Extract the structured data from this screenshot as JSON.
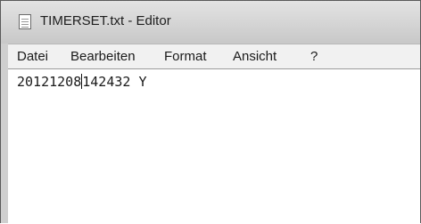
{
  "window": {
    "title": "TIMERSET.txt - Editor"
  },
  "menu": {
    "items": [
      {
        "label": "Datei"
      },
      {
        "label": "Bearbeiten"
      },
      {
        "label": "Format"
      },
      {
        "label": "Ansicht"
      },
      {
        "label": "?"
      }
    ]
  },
  "editor": {
    "text_before_caret": "20121208",
    "text_after_caret": "142432 Y"
  },
  "icons": {
    "app": "notepad-icon"
  }
}
